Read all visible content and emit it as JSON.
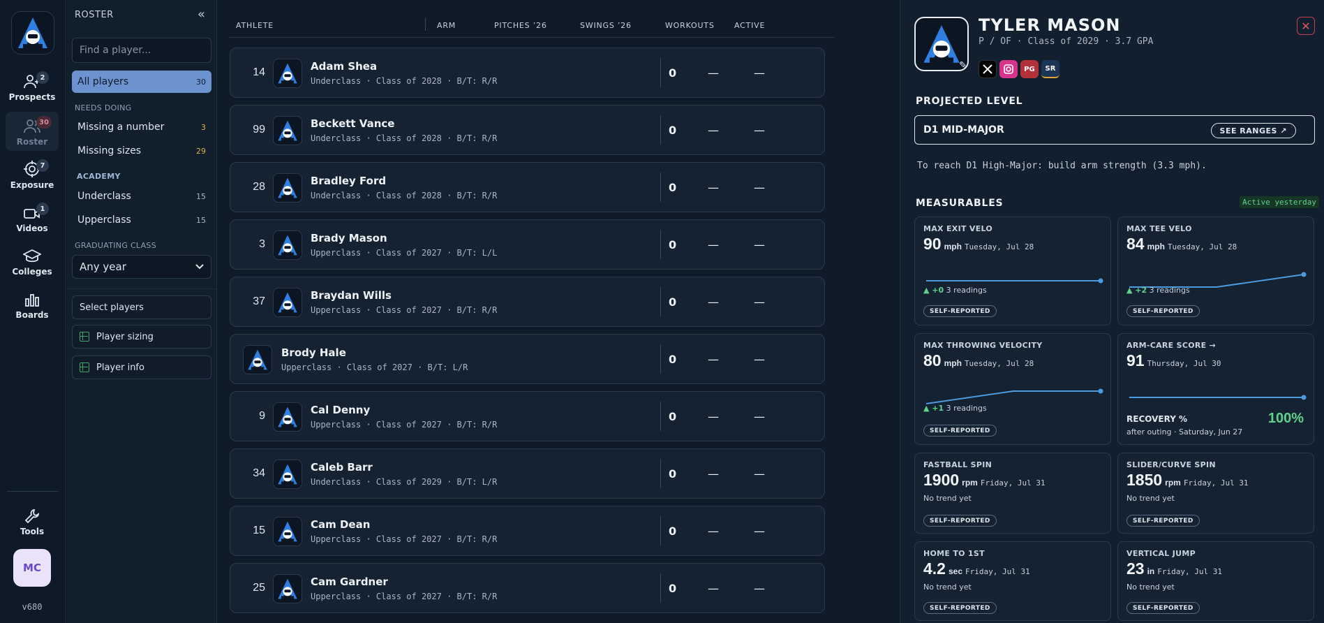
{
  "rail": {
    "version": "v680",
    "avatar_initials": "MC",
    "items": [
      {
        "label": "Prospects",
        "badge": "2"
      },
      {
        "label": "Roster",
        "badge": "30"
      },
      {
        "label": "Exposure",
        "badge": "7"
      },
      {
        "label": "Videos",
        "badge": "1"
      },
      {
        "label": "Colleges"
      },
      {
        "label": "Boards"
      },
      {
        "label": "Tools"
      }
    ]
  },
  "sidebar": {
    "title": "ROSTER",
    "collapse_glyph": "«",
    "search_placeholder": "Find a player...",
    "all_players": {
      "label": "All players",
      "count": "30"
    },
    "needs_doing_label": "NEEDS DOING",
    "needs_doing": [
      {
        "label": "Missing a number",
        "count": "3"
      },
      {
        "label": "Missing sizes",
        "count": "29"
      }
    ],
    "academy_label": "ACADEMY",
    "academy": [
      {
        "label": "Underclass",
        "count": "15"
      },
      {
        "label": "Upperclass",
        "count": "15"
      }
    ],
    "grad_label": "GRADUATING CLASS",
    "grad_value": "Any year",
    "select_players": "Select players",
    "player_sizing": "Player sizing",
    "player_info": "Player info"
  },
  "table": {
    "headers": {
      "athlete": "ATHLETE",
      "arm": "ARM",
      "pitches": "PITCHES ’26",
      "swings": "SWINGS ’26",
      "workouts": "WORKOUTS",
      "active": "ACTIVE"
    },
    "rows": [
      {
        "number": "14",
        "name": "Adam Shea",
        "meta": "Underclass · Class of 2028 · B/T: R/R",
        "arm": "0",
        "d1": "—",
        "d2": "—"
      },
      {
        "number": "99",
        "name": "Beckett Vance",
        "meta": "Underclass · Class of 2028 · B/T: R/R",
        "arm": "0",
        "d1": "—",
        "d2": "—"
      },
      {
        "number": "28",
        "name": "Bradley Ford",
        "meta": "Underclass · Class of 2028 · B/T: R/R",
        "arm": "0",
        "d1": "—",
        "d2": "—"
      },
      {
        "number": "3",
        "name": "Brady Mason",
        "meta": "Upperclass · Class of 2027 · B/T: L/L",
        "arm": "0",
        "d1": "—",
        "d2": "—"
      },
      {
        "number": "37",
        "name": "Braydan Wills",
        "meta": "Upperclass · Class of 2027 · B/T: R/R",
        "arm": "0",
        "d1": "—",
        "d2": "—"
      },
      {
        "number": "",
        "name": "Brody Hale",
        "meta": "Upperclass · Class of 2027 · B/T: L/R",
        "arm": "0",
        "d1": "—",
        "d2": "—"
      },
      {
        "number": "9",
        "name": "Cal Denny",
        "meta": "Upperclass · Class of 2027 · B/T: R/R",
        "arm": "0",
        "d1": "—",
        "d2": "—"
      },
      {
        "number": "34",
        "name": "Caleb Barr",
        "meta": "Underclass · Class of 2029 · B/T: L/R",
        "arm": "0",
        "d1": "—",
        "d2": "—"
      },
      {
        "number": "15",
        "name": "Cam Dean",
        "meta": "Upperclass · Class of 2027 · B/T: R/R",
        "arm": "0",
        "d1": "—",
        "d2": "—"
      },
      {
        "number": "25",
        "name": "Cam Gardner",
        "meta": "Upperclass · Class of 2027 · B/T: R/R",
        "arm": "0",
        "d1": "—",
        "d2": "—"
      }
    ]
  },
  "panel": {
    "name": "TYLER MASON",
    "subtitle": "P / OF · Class of 2029 · 3.7 GPA",
    "socials": [
      "X",
      "IG",
      "PG",
      "SR"
    ],
    "projected_label": "PROJECTED LEVEL",
    "level": "D1 MID-MAJOR",
    "see_ranges": "SEE RANGES ↗",
    "hint": "To reach D1 High-Major: build arm strength (3.3 mph).",
    "measurables_label": "MEASURABLES",
    "active_tag": "Active yesterday",
    "self_reported": "SELF-REPORTED",
    "cards": [
      {
        "label": "MAX EXIT VELO",
        "value": "90",
        "unit": "mph",
        "date": "Tuesday, Jul 28",
        "trend_delta": "▲ +0",
        "trend_text": "3 readings",
        "spark": [
          90,
          90,
          90
        ]
      },
      {
        "label": "MAX TEE VELO",
        "value": "84",
        "unit": "mph",
        "date": "Tuesday, Jul 28",
        "trend_delta": "▲ +2",
        "trend_text": "3 readings",
        "spark": [
          82,
          82,
          84
        ]
      },
      {
        "label": "MAX THROWING VELOCITY",
        "value": "80",
        "unit": "mph",
        "date": "Tuesday, Jul 28",
        "trend_delta": "▲ +1",
        "trend_text": "3 readings",
        "spark": [
          79,
          80,
          80
        ]
      },
      {
        "label": "ARM-CARE SCORE →",
        "value": "91",
        "unit": "",
        "date": "Thursday, Jul 30",
        "spark": [
          91,
          91
        ],
        "recovery_label": "RECOVERY %",
        "recovery_value": "100%",
        "recovery_sub": "after outing · Saturday, Jun 27"
      },
      {
        "label": "FASTBALL SPIN",
        "value": "1900",
        "unit": "rpm",
        "date": "Friday, Jul 31",
        "no_trend": "No trend yet"
      },
      {
        "label": "SLIDER/CURVE SPIN",
        "value": "1850",
        "unit": "rpm",
        "date": "Friday, Jul 31",
        "no_trend": "No trend yet"
      },
      {
        "label": "HOME TO 1ST",
        "value": "4.2",
        "unit": "sec",
        "date": "Friday, Jul 31",
        "no_trend": "No trend yet"
      },
      {
        "label": "VERTICAL JUMP",
        "value": "23",
        "unit": "in",
        "date": "Friday, Jul 31",
        "no_trend": "No trend yet"
      }
    ]
  },
  "colors": {
    "accent": "#6c93cf",
    "positive": "#5fd38c",
    "warning": "#e0b24a",
    "danger": "#e25563",
    "spark": "#4a9be0"
  }
}
